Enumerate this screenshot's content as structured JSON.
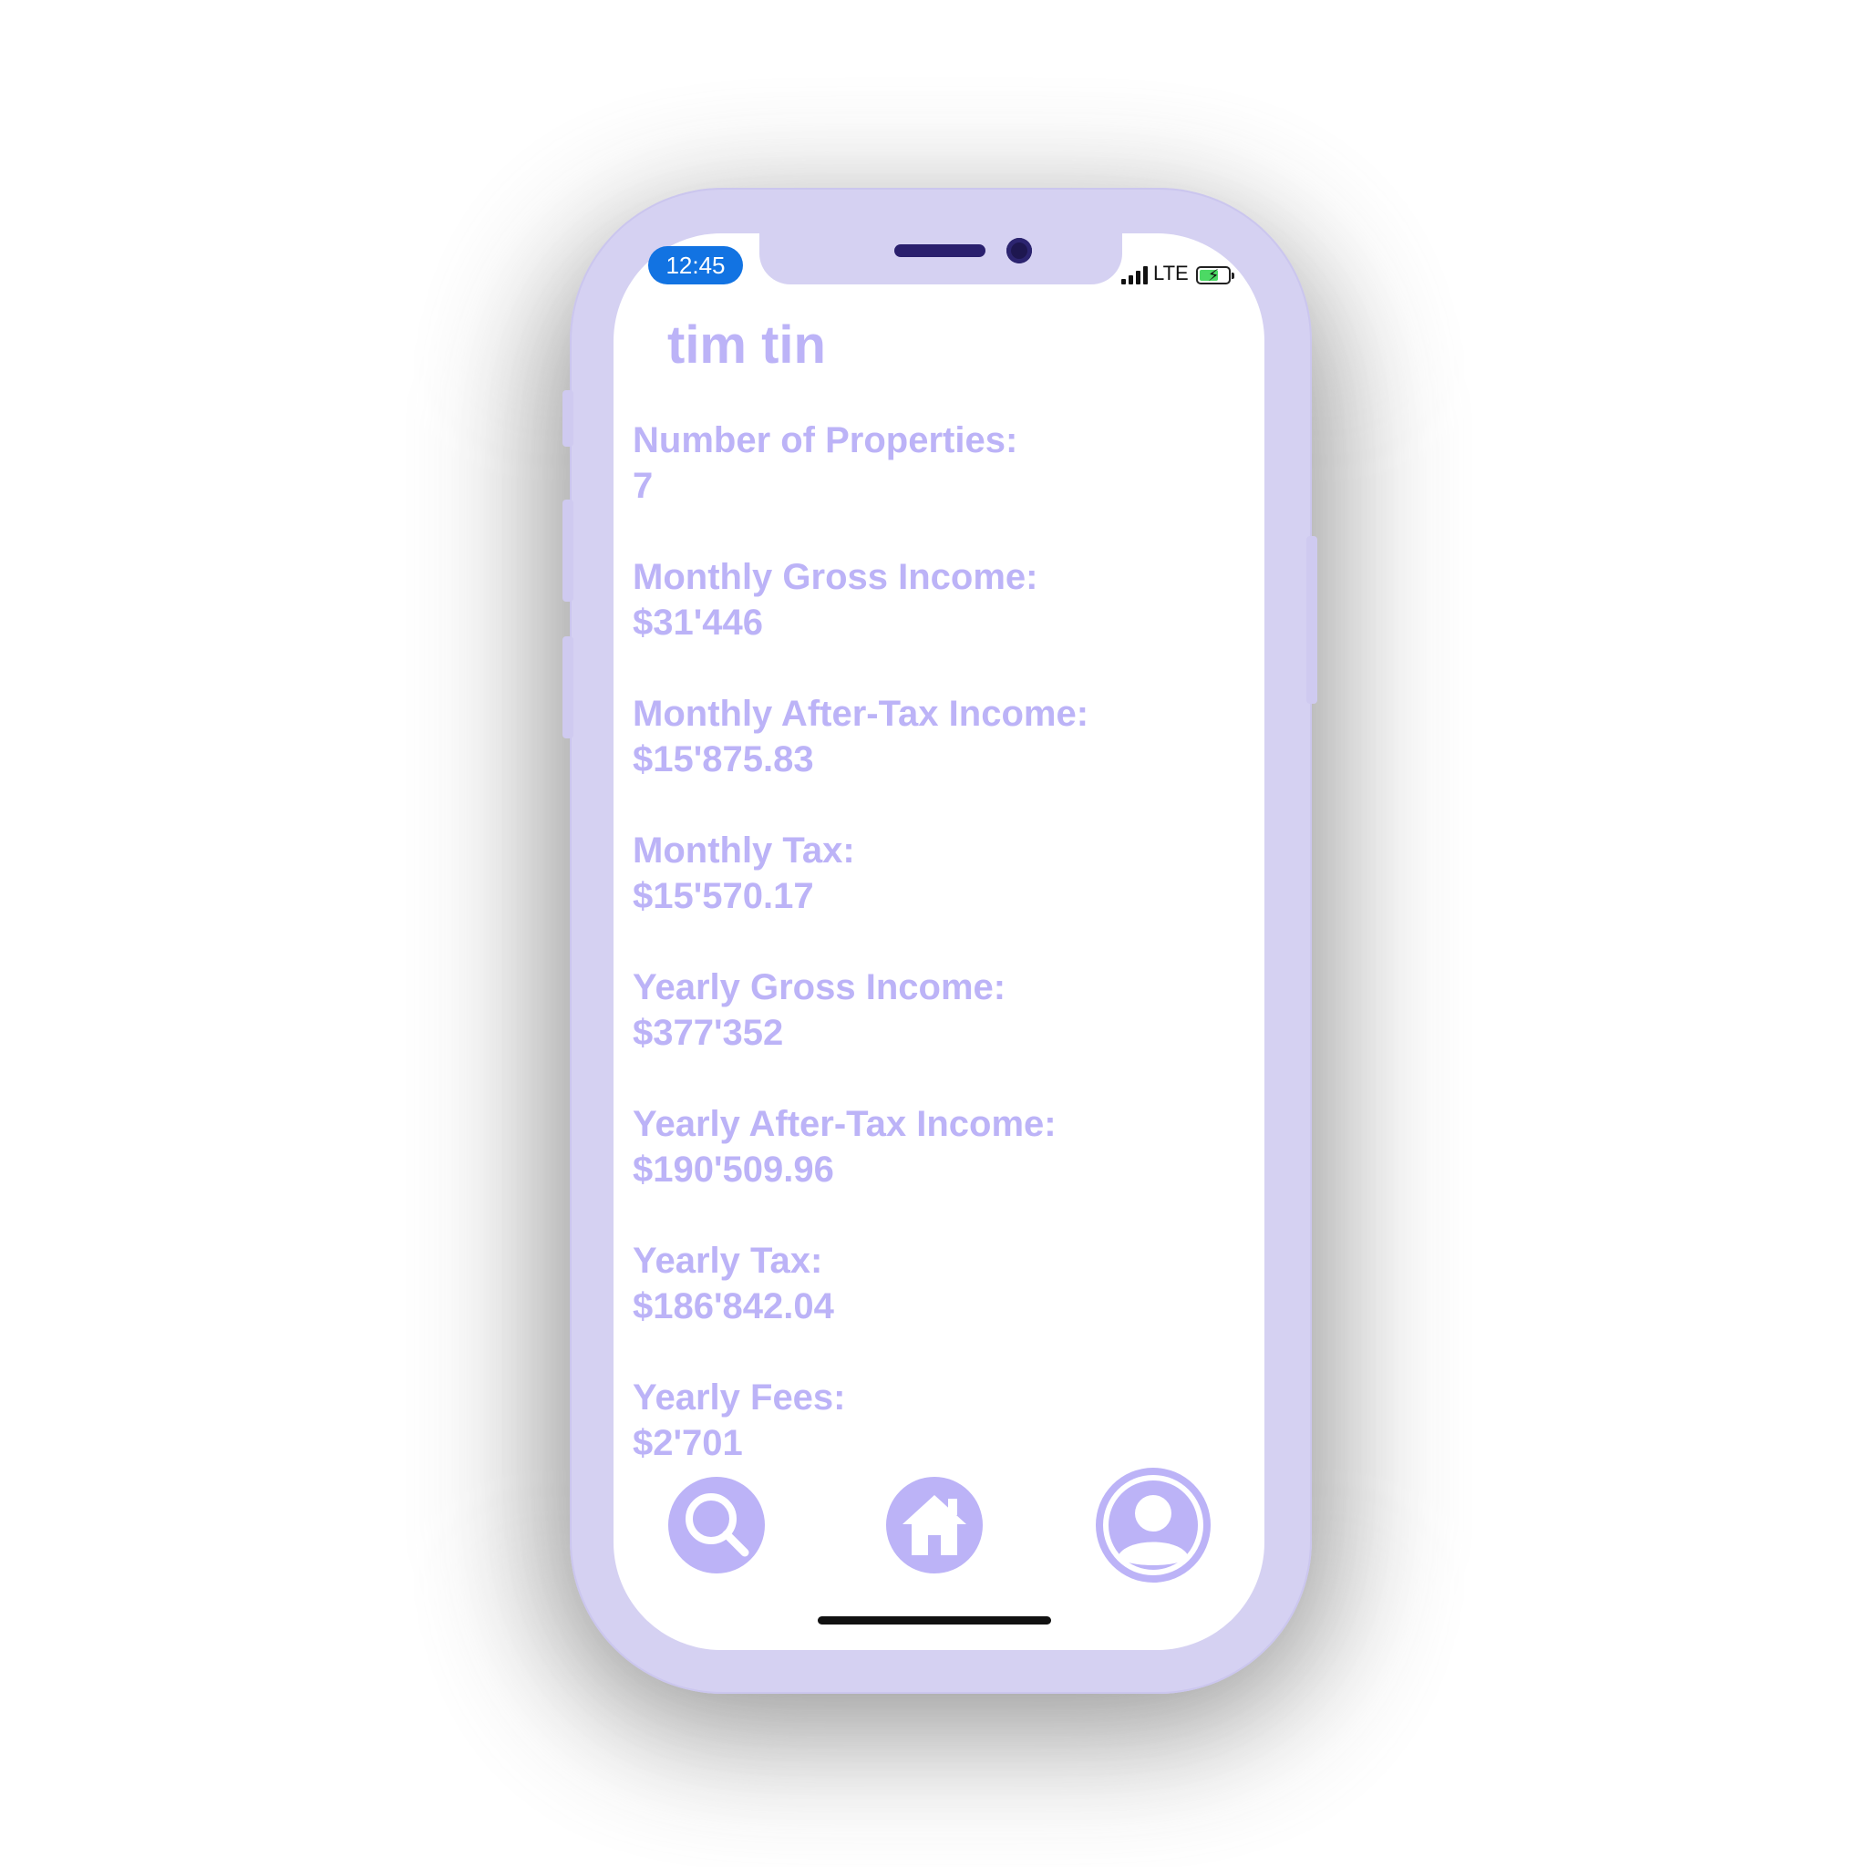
{
  "status_bar": {
    "time": "12:45",
    "network": "LTE"
  },
  "profile": {
    "name": "tim tin"
  },
  "stats": [
    {
      "label": "Number of Properties:",
      "value": "7"
    },
    {
      "label": "Monthly Gross Income:",
      "value": "$31'446"
    },
    {
      "label": "Monthly After-Tax Income:",
      "value": "$15'875.83"
    },
    {
      "label": "Monthly Tax:",
      "value": "$15'570.17"
    },
    {
      "label": "Yearly Gross Income:",
      "value": "$377'352"
    },
    {
      "label": "Yearly After-Tax Income:",
      "value": "$190'509.96"
    },
    {
      "label": "Yearly Tax:",
      "value": "$186'842.04"
    },
    {
      "label": "Yearly Fees:",
      "value": "$2'701"
    }
  ],
  "nav": {
    "items": [
      {
        "icon": "search-icon"
      },
      {
        "icon": "home-icon"
      },
      {
        "icon": "profile-icon"
      }
    ]
  },
  "colors": {
    "accent": "#bcb3f7",
    "phone_frame": "#d5d1f2",
    "time_pill": "#1273e2",
    "battery_fill": "#4cd964"
  }
}
